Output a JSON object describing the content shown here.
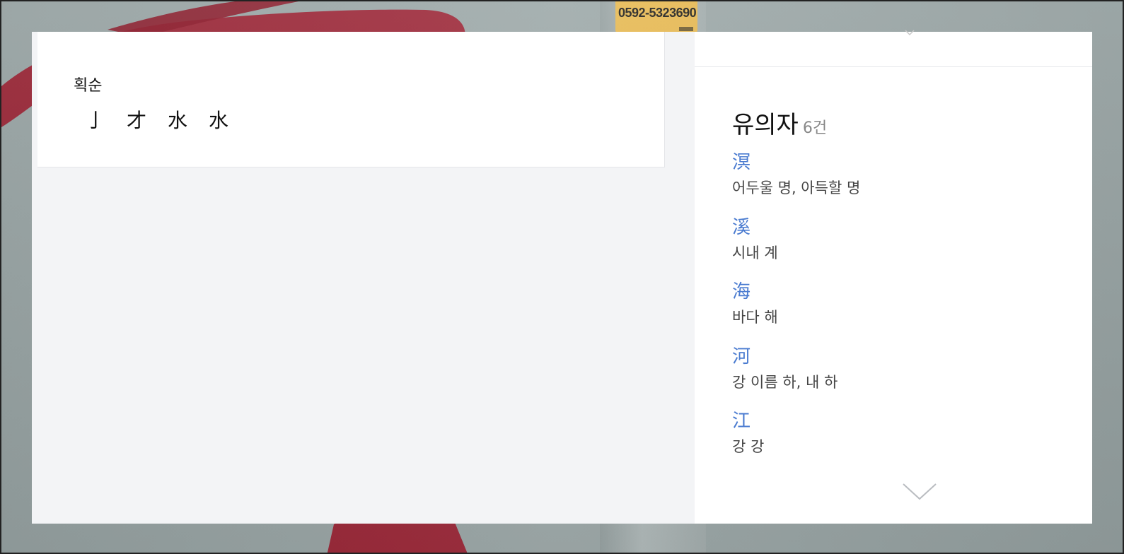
{
  "background": {
    "sticker_text": "0592-5323690",
    "wall_color": "#9aa6a6",
    "graffiti_color": "#9b1c2e"
  },
  "stroke_order": {
    "title": "획순",
    "steps": [
      "亅",
      "才",
      "水",
      "水"
    ]
  },
  "similar": {
    "heading": "유의자",
    "count": "6건",
    "items": [
      {
        "hanja": "溟",
        "meaning": "어두울 명, 아득할 명"
      },
      {
        "hanja": "溪",
        "meaning": "시내 계"
      },
      {
        "hanja": "海",
        "meaning": "바다 해"
      },
      {
        "hanja": "河",
        "meaning": "강 이름 하, 내 하"
      },
      {
        "hanja": "江",
        "meaning": "강 강"
      }
    ],
    "link_color": "#4a7bd0"
  },
  "icons": {
    "collapse": "chevron-up-icon",
    "expand": "chevron-down-icon"
  }
}
